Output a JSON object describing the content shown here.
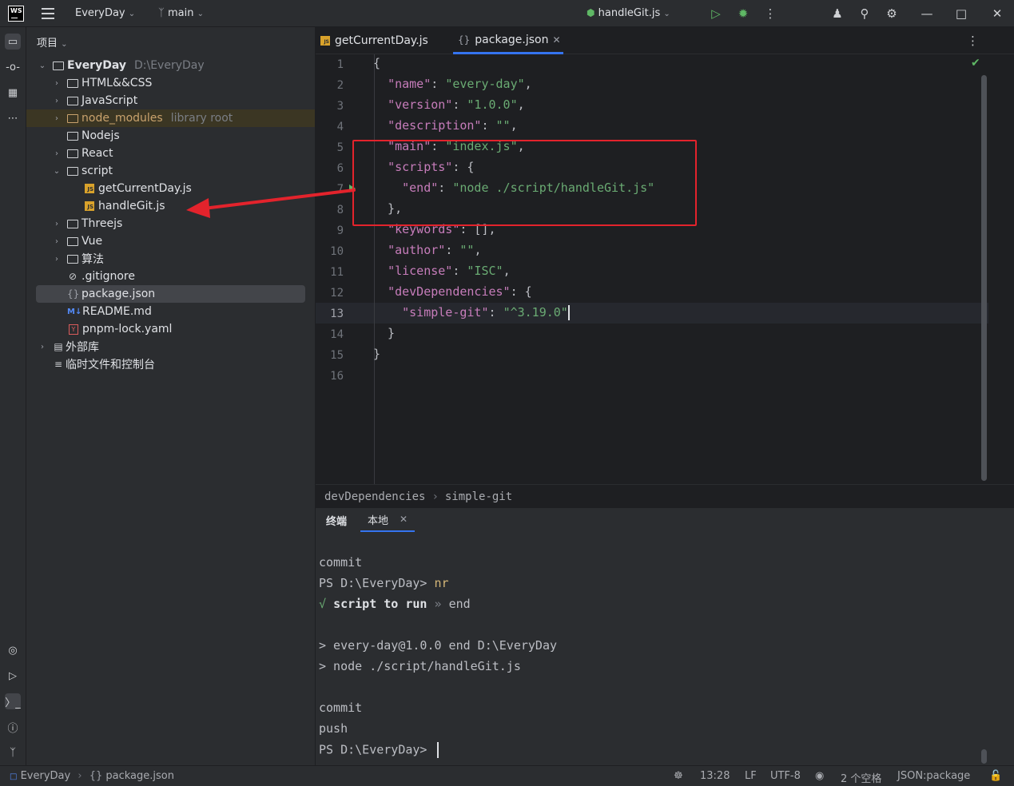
{
  "titlebar": {
    "logo_text": "WS",
    "project_name": "EveryDay",
    "branch": "main",
    "run_config": "handleGit.js"
  },
  "project_panel": {
    "header": "项目",
    "root_name": "EveryDay",
    "root_path": "D:\\EveryDay",
    "items": [
      {
        "label": "HTML&&CSS"
      },
      {
        "label": "JavaScript"
      },
      {
        "label": "node_modules",
        "suffix": "library root"
      },
      {
        "label": "Nodejs"
      },
      {
        "label": "React"
      },
      {
        "label": "script"
      },
      {
        "label": "getCurrentDay.js"
      },
      {
        "label": "handleGit.js"
      },
      {
        "label": "Threejs"
      },
      {
        "label": "Vue"
      },
      {
        "label": "算法"
      },
      {
        "label": ".gitignore"
      },
      {
        "label": "package.json"
      },
      {
        "label": "README.md"
      },
      {
        "label": "pnpm-lock.yaml"
      },
      {
        "label": "外部库"
      },
      {
        "label": "临时文件和控制台"
      }
    ]
  },
  "editor_tabs": [
    {
      "label": "getCurrentDay.js"
    },
    {
      "label": "package.json"
    }
  ],
  "editor": {
    "line_numbers": [
      "1",
      "2",
      "3",
      "4",
      "5",
      "6",
      "7",
      "8",
      "9",
      "10",
      "11",
      "12",
      "13",
      "14",
      "15",
      "16"
    ],
    "lines": [
      {
        "parts": [
          "{"
        ]
      },
      {
        "parts": [
          "  ",
          "\"name\"",
          ": ",
          "\"every-day\"",
          ","
        ]
      },
      {
        "parts": [
          "  ",
          "\"version\"",
          ": ",
          "\"1.0.0\"",
          ","
        ]
      },
      {
        "parts": [
          "  ",
          "\"description\"",
          ": ",
          "\"\"",
          ","
        ]
      },
      {
        "parts": [
          "  ",
          "\"main\"",
          ": ",
          "\"index.js\"",
          ","
        ]
      },
      {
        "parts": [
          "  ",
          "\"scripts\"",
          ": {",
          "",
          ""
        ]
      },
      {
        "parts": [
          "    ",
          "\"end\"",
          ": ",
          "\"node ./script/handleGit.js\"",
          ""
        ]
      },
      {
        "parts": [
          "  },"
        ]
      },
      {
        "parts": [
          "  ",
          "\"keywords\"",
          ": [],",
          "",
          ""
        ]
      },
      {
        "parts": [
          "  ",
          "\"author\"",
          ": ",
          "\"\"",
          ","
        ]
      },
      {
        "parts": [
          "  ",
          "\"license\"",
          ": ",
          "\"ISC\"",
          ","
        ]
      },
      {
        "parts": [
          "  ",
          "\"devDependencies\"",
          ": {",
          "",
          ""
        ]
      },
      {
        "parts": [
          "    ",
          "\"simple-git\"",
          ": ",
          "\"^3.19.0\"",
          ""
        ]
      },
      {
        "parts": [
          "  }"
        ]
      },
      {
        "parts": [
          "}"
        ]
      },
      {
        "parts": [
          ""
        ]
      }
    ]
  },
  "breadcrumb": [
    "devDependencies",
    "simple-git"
  ],
  "terminal": {
    "tabs": [
      "终端",
      "本地"
    ],
    "lines": [
      {
        "text": "commit"
      },
      {
        "prompt": "PS D:\\EveryDay> ",
        "cmd": "nr"
      },
      {
        "check": "√ ",
        "bold": "script to run",
        "sep": " » ",
        "rest": "end"
      },
      {
        "text": ""
      },
      {
        "text": "> every-day@1.0.0 end D:\\EveryDay"
      },
      {
        "text": "> node ./script/handleGit.js"
      },
      {
        "text": ""
      },
      {
        "text": "commit"
      },
      {
        "text": "push"
      },
      {
        "prompt": "PS D:\\EveryDay> ",
        "cmd": ""
      }
    ]
  },
  "statusbar": {
    "project": "EveryDay",
    "file": "package.json",
    "position": "13:28",
    "line_sep": "LF",
    "encoding": "UTF-8",
    "indent": "2 个空格",
    "schema": "JSON:package"
  },
  "colors": {
    "accent": "#3574f0",
    "annotation": "#e3232c",
    "string": "#6aab73",
    "key": "#c77dbb"
  }
}
